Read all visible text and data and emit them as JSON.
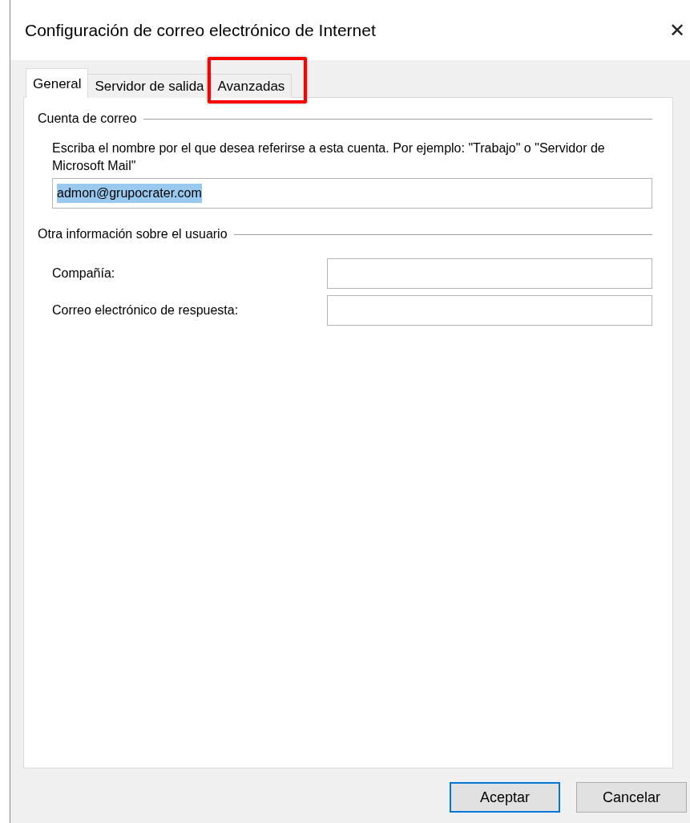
{
  "window": {
    "title": "Configuración de correo electrónico de Internet",
    "close": "✕"
  },
  "tabs": [
    {
      "label": "General",
      "selected": true,
      "highlighted": false
    },
    {
      "label": "Servidor de salida",
      "selected": false,
      "highlighted": false
    },
    {
      "label": "Avanzadas",
      "selected": false,
      "highlighted": true
    }
  ],
  "sections": [
    {
      "title": "Cuenta de correo",
      "description": "Escriba el nombre por el que desea referirse a esta cuenta. Por ejemplo: \"Trabajo\" o \"Servidor de Microsoft Mail\"",
      "field": {
        "value": "admon@grupocrater.com",
        "selected_text": true
      }
    },
    {
      "title": "Otra información sobre el usuario",
      "rows": [
        {
          "label": "Compañía:"
        },
        {
          "label": "Correo electrónico de respuesta:"
        }
      ]
    }
  ],
  "buttons": [
    {
      "label": "Aceptar",
      "default": true
    },
    {
      "label": "Cancelar",
      "default": false
    }
  ]
}
